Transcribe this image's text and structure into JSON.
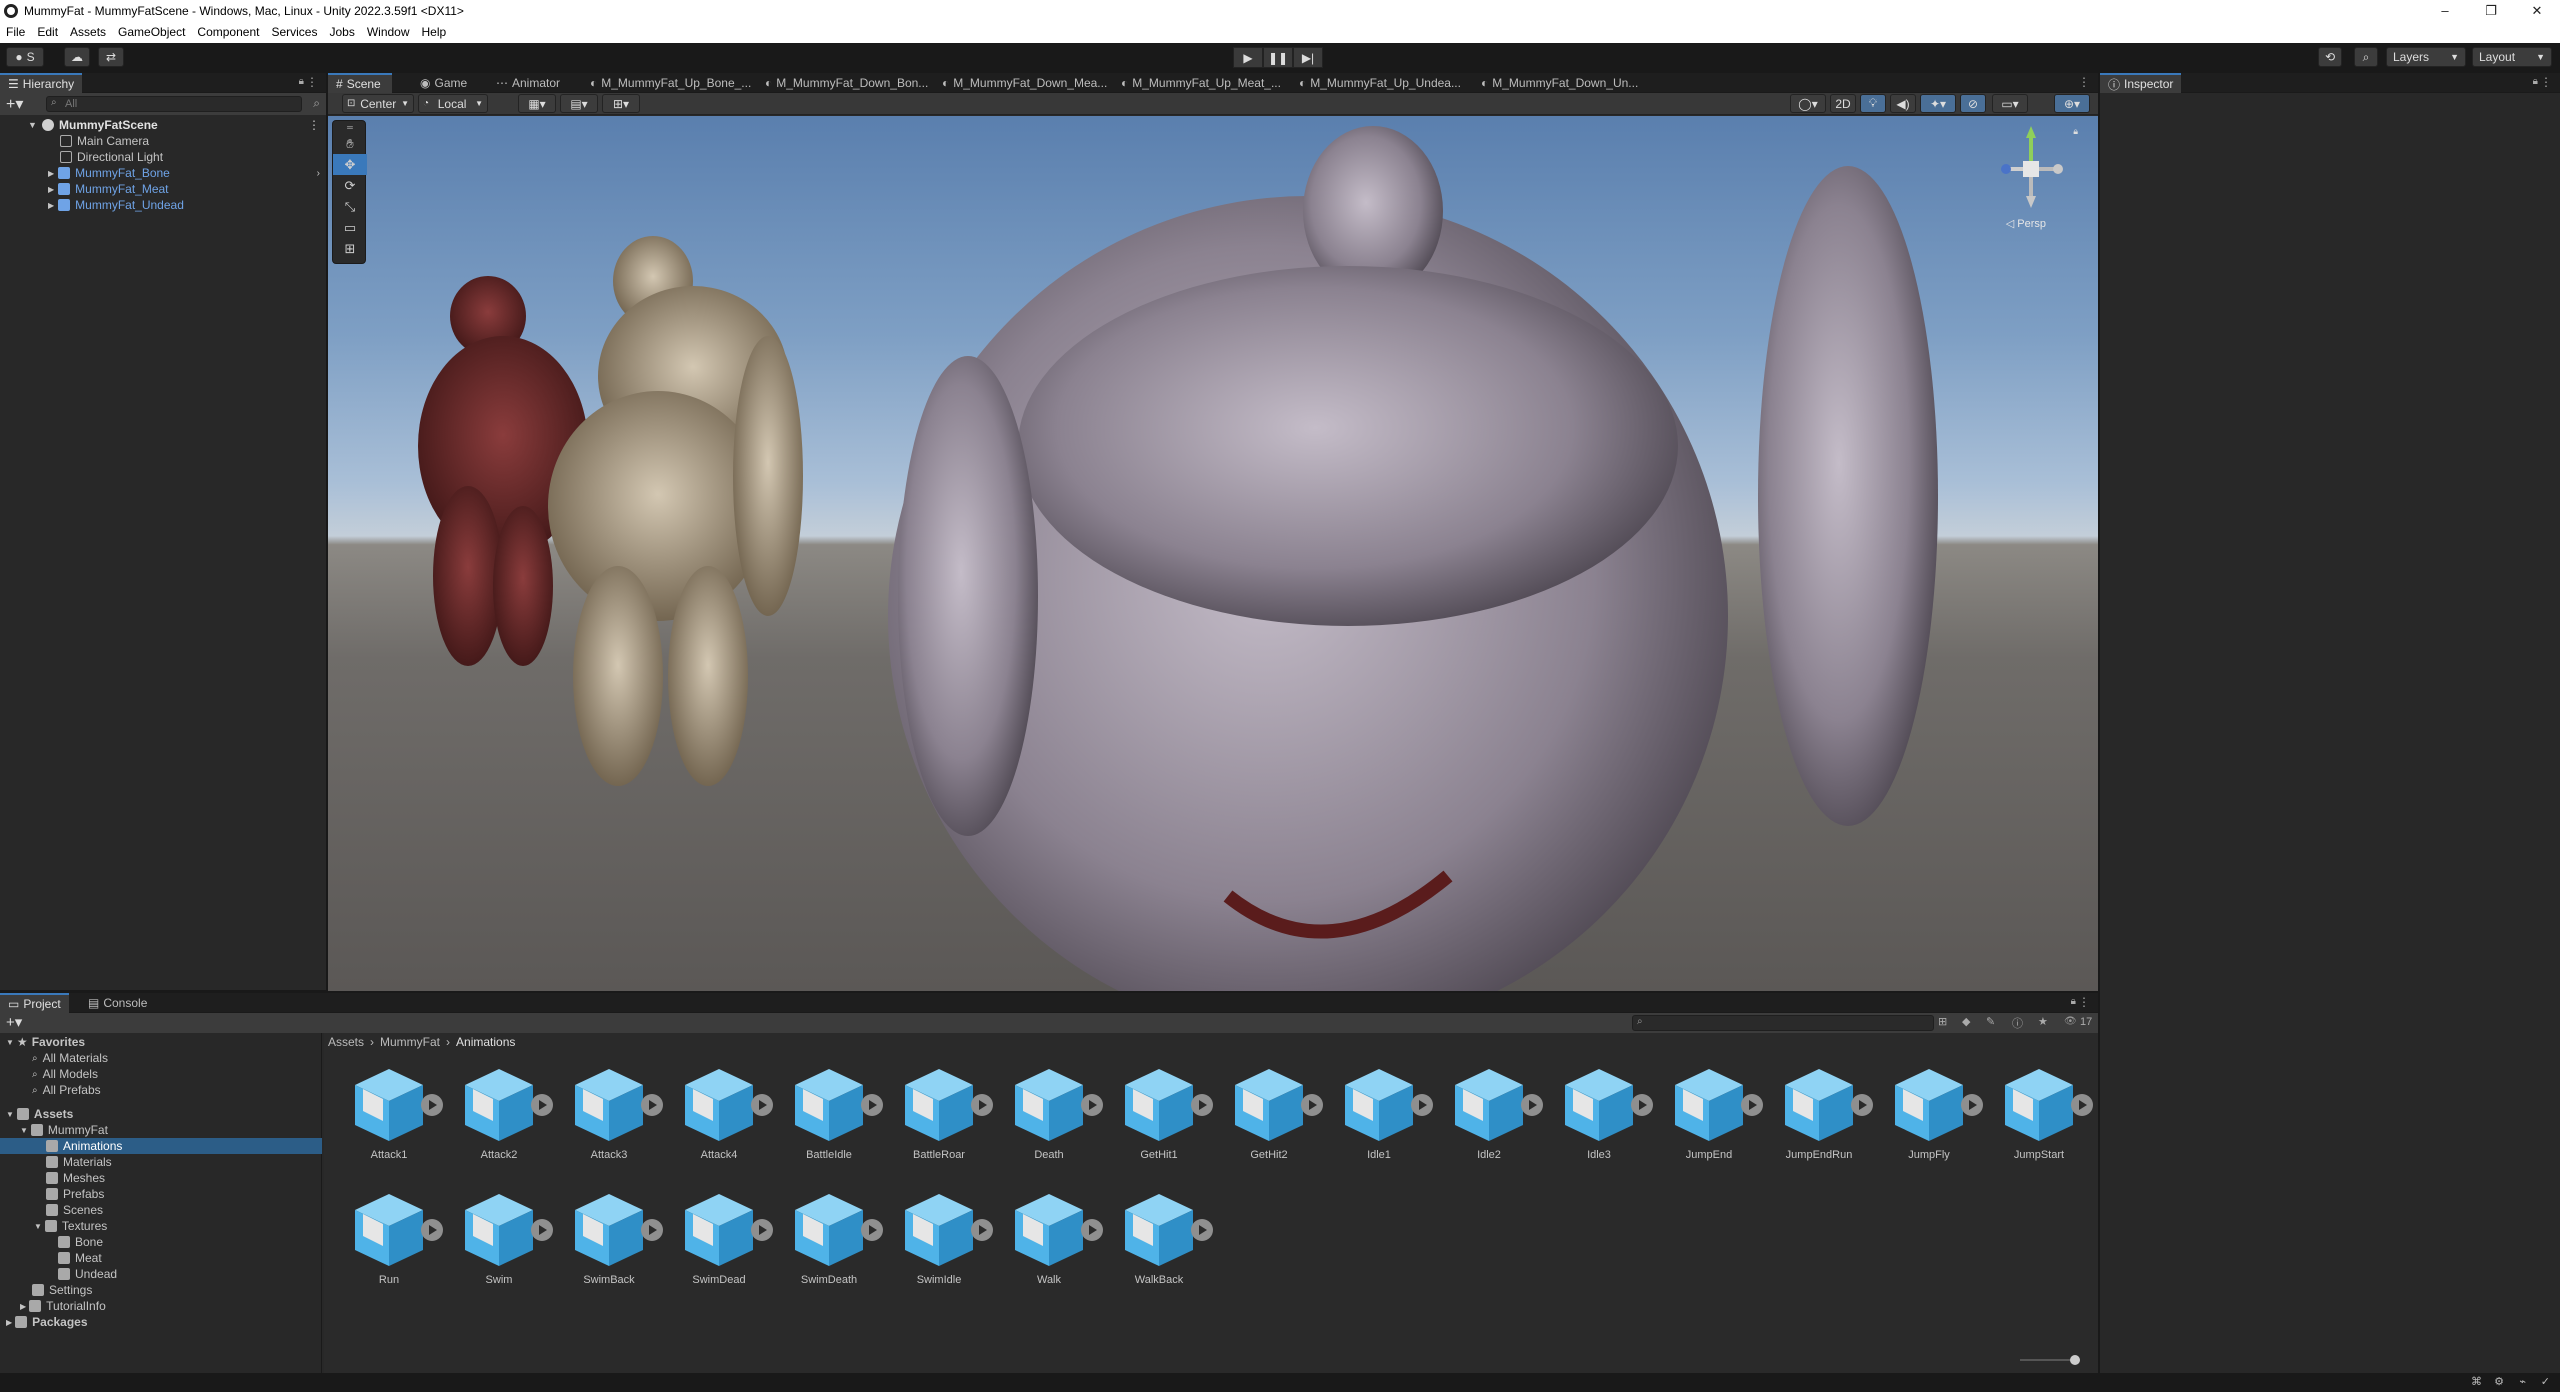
{
  "window": {
    "title": "MummyFat - MummyFatScene - Windows, Mac, Linux - Unity 2022.3.59f1 <DX11>",
    "controls": [
      "–",
      "❐",
      "✕"
    ]
  },
  "menu": [
    "File",
    "Edit",
    "Assets",
    "GameObject",
    "Component",
    "Services",
    "Jobs",
    "Window",
    "Help"
  ],
  "toolbar": {
    "account": "S",
    "layers": "Layers",
    "layout": "Layout"
  },
  "hierarchy": {
    "tab": "Hierarchy",
    "search_placeholder": "All",
    "scene": "MummyFatScene",
    "items": [
      {
        "label": "Main Camera",
        "prefab": false
      },
      {
        "label": "Directional Light",
        "prefab": false
      },
      {
        "label": "MummyFat_Bone",
        "prefab": true
      },
      {
        "label": "MummyFat_Meat",
        "prefab": true
      },
      {
        "label": "MummyFat_Undead",
        "prefab": true
      }
    ]
  },
  "scene": {
    "tabs": [
      "Scene",
      "Game",
      "Animator",
      "M_MummyFat_Up_Bone_...",
      "M_MummyFat_Down_Bon...",
      "M_MummyFat_Down_Mea...",
      "M_MummyFat_Up_Meat_...",
      "M_MummyFat_Up_Undea...",
      "M_MummyFat_Down_Un..."
    ],
    "pivot": "Center",
    "space": "Local",
    "mode_2d": "2D",
    "persp": "◁ Persp"
  },
  "inspector": {
    "tab": "Inspector"
  },
  "project": {
    "tabs": [
      "Project",
      "Console"
    ],
    "favorites_label": "Favorites",
    "favorites": [
      "All Materials",
      "All Models",
      "All Prefabs"
    ],
    "assets_label": "Assets",
    "mummyfat_label": "MummyFat",
    "mummyfat_children": [
      "Animations",
      "Materials",
      "Meshes",
      "Prefabs",
      "Scenes",
      "Textures"
    ],
    "texture_children": [
      "Bone",
      "Meat",
      "Undead"
    ],
    "other_assets": [
      "Settings",
      "TutorialInfo"
    ],
    "packages_label": "Packages",
    "breadcrumb": [
      "Assets",
      "MummyFat",
      "Animations"
    ],
    "count": "17",
    "clips": [
      "Attack1",
      "Attack2",
      "Attack3",
      "Attack4",
      "BattleIdle",
      "BattleRoar",
      "Death",
      "GetHit1",
      "GetHit2",
      "Idle1",
      "Idle2",
      "Idle3",
      "JumpEnd",
      "JumpEndRun",
      "JumpFly",
      "JumpStart",
      "Run",
      "Swim",
      "SwimBack",
      "SwimDead",
      "SwimDeath",
      "SwimIdle",
      "Walk",
      "WalkBack"
    ]
  },
  "colors": {
    "accent": "#3a79bb",
    "prefab_text": "#6fa3e6",
    "cube_blue": "#4fb3e8"
  }
}
